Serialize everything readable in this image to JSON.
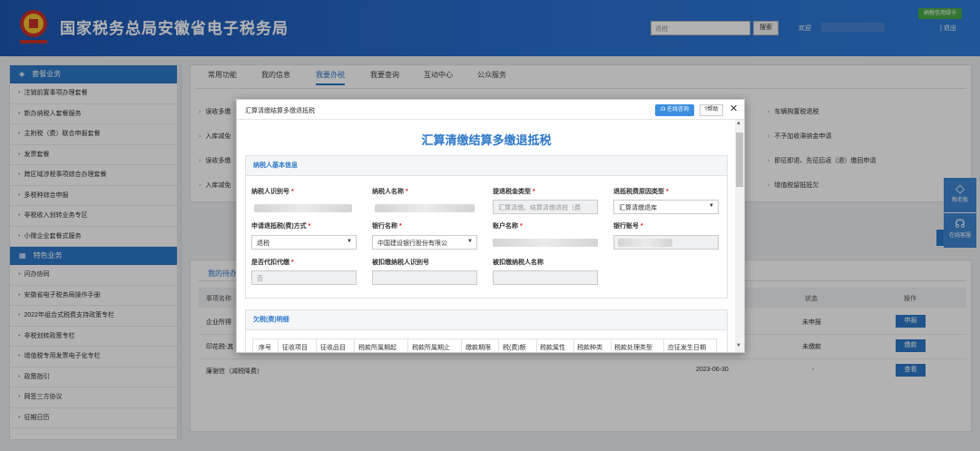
{
  "header": {
    "title": "国家税务总局安徽省电子税务局",
    "search_value": "退税",
    "search_button": "搜索",
    "welcome": "欢迎",
    "logout": "退出",
    "credit_badge": "纳税信用绿卡"
  },
  "sidebar": {
    "section1": "套餐业务",
    "section1_items": [
      "注销前置事项办理套餐",
      "新办纳税人套餐服务",
      "主附税（费）联合申报套餐",
      "发票套餐",
      "跨区域涉税事项综合办理套餐",
      "多税种综合申报",
      "非税收入划转业务专区",
      "小微企业套餐式服务"
    ],
    "section2": "特色业务",
    "section2_items": [
      "问办协同",
      "安徽省电子税务局操作手册",
      "2022年组合式税费支持政策专栏",
      "非税划转政策专栏",
      "增值税专用发票电子化专栏",
      "政策指引",
      "网签三方协议",
      "征期日历"
    ]
  },
  "main": {
    "tabs": [
      "常用功能",
      "我的信息",
      "我要办税",
      "我要查询",
      "互动中心",
      "公众服务"
    ],
    "bg_links_left": [
      "误收多缴",
      "入库减免",
      "误收多缴",
      "入库减免"
    ],
    "bg_links_right": [
      "车辆购置税退税",
      "不予加收滞纳金申请",
      "即征即退、先征后返（退）缴回申请",
      "增值税留抵抵欠"
    ]
  },
  "todo": {
    "tab": "我的待办",
    "headers": {
      "name": "事项名称",
      "status": "状态",
      "action": "操作"
    },
    "rows": [
      {
        "name": "企业所得",
        "date": "",
        "status": "未申报",
        "action": "申报"
      },
      {
        "name": "印花税-其",
        "date": "",
        "status": "未缴款",
        "action": "缴款"
      },
      {
        "name": "廉谢信（减税降费）",
        "date": "2023-06-30",
        "status": "-",
        "action": "查看"
      }
    ]
  },
  "float": {
    "sign": "税老板",
    "service": "在线客服"
  },
  "modal": {
    "title": "汇算清缴结算多缴退抵税",
    "cs_button": "在线咨询",
    "help_button": "帮助",
    "close": "✕",
    "heading": "汇算清缴结算多缴退抵税",
    "section_basic": "纳税人基本信息",
    "labels": {
      "taxpayer_id": "纳税人识别号",
      "taxpayer_name": "纳税人名称",
      "refund_type": "提退税金类型",
      "refund_reason": "退抵税费原因类型",
      "refund_method": "申请退抵税(费)方式",
      "bank_name": "银行名称",
      "account_name": "账户名称",
      "bank_account": "银行账号",
      "withholding": "是否代扣代缴",
      "withheld_id": "被扣缴纳税人识别号",
      "withheld_name": "被扣缴纳税人名称"
    },
    "values": {
      "refund_type_placeholder": "汇算清缴、结算清缴退税（费",
      "refund_reason": "汇算清缴退库",
      "refund_method": "退税",
      "bank_name": "中国建设银行股份有限公",
      "withholding": "否"
    },
    "section_arrears": "欠税(费)明细",
    "table_headers": [
      "序号",
      "征收项目",
      "征收品目",
      "税款所属期起",
      "税款所属期止",
      "缴款期限",
      "税(费)额",
      "税款属性",
      "税款种类",
      "税款处理类型",
      "应征发生日期"
    ]
  }
}
